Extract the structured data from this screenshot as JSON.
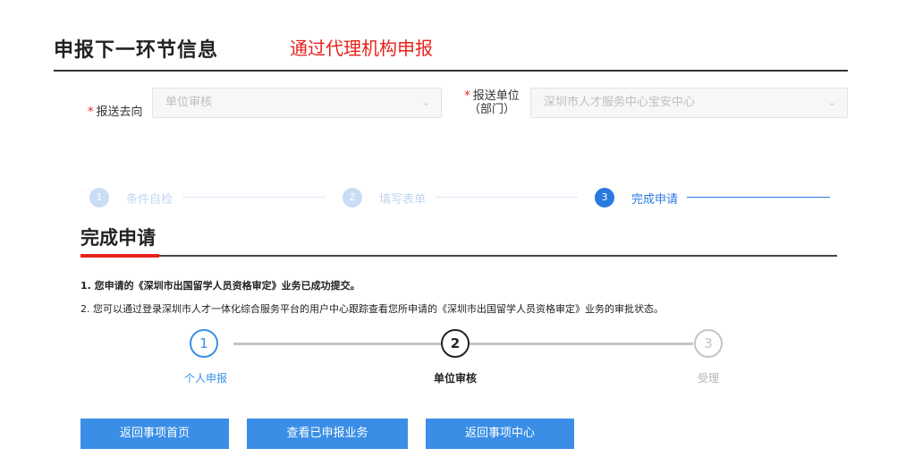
{
  "header": {
    "title": "申报下一环节信息",
    "subtitle": "通过代理机构申报"
  },
  "form": {
    "destination": {
      "label": "报送去向",
      "required_mark": "*",
      "value": "单位审核"
    },
    "unit": {
      "label_line1": "报送单位",
      "label_line2": "（部门）",
      "required_mark": "*",
      "value": "深圳市人才服务中心宝安中心"
    }
  },
  "progress_steps": [
    {
      "number": "1",
      "label": "条件自检",
      "state": "inactive"
    },
    {
      "number": "2",
      "label": "填写表单",
      "state": "inactive"
    },
    {
      "number": "3",
      "label": "完成申请",
      "state": "active"
    }
  ],
  "completion": {
    "title": "完成申请",
    "message1": "1. 您申请的《深圳市出国留学人员资格审定》业务已成功提交。",
    "message2": "2. 您可以通过登录深圳市人才一体化综合服务平台的用户中心跟踪查看您所申请的《深圳市出国留学人员资格审定》业务的审批状态。"
  },
  "approval_flow": [
    {
      "number": "1",
      "label": "个人申报",
      "state": "done"
    },
    {
      "number": "2",
      "label": "单位审核",
      "state": "current"
    },
    {
      "number": "3",
      "label": "受理",
      "state": "pending"
    }
  ],
  "buttons": {
    "home": "返回事项首页",
    "view_applied": "查看已申报业务",
    "center": "返回事项中心"
  },
  "colors": {
    "accent_blue": "#3a8ee6",
    "step_blue": "#2a79e0",
    "red": "#e8211b"
  }
}
